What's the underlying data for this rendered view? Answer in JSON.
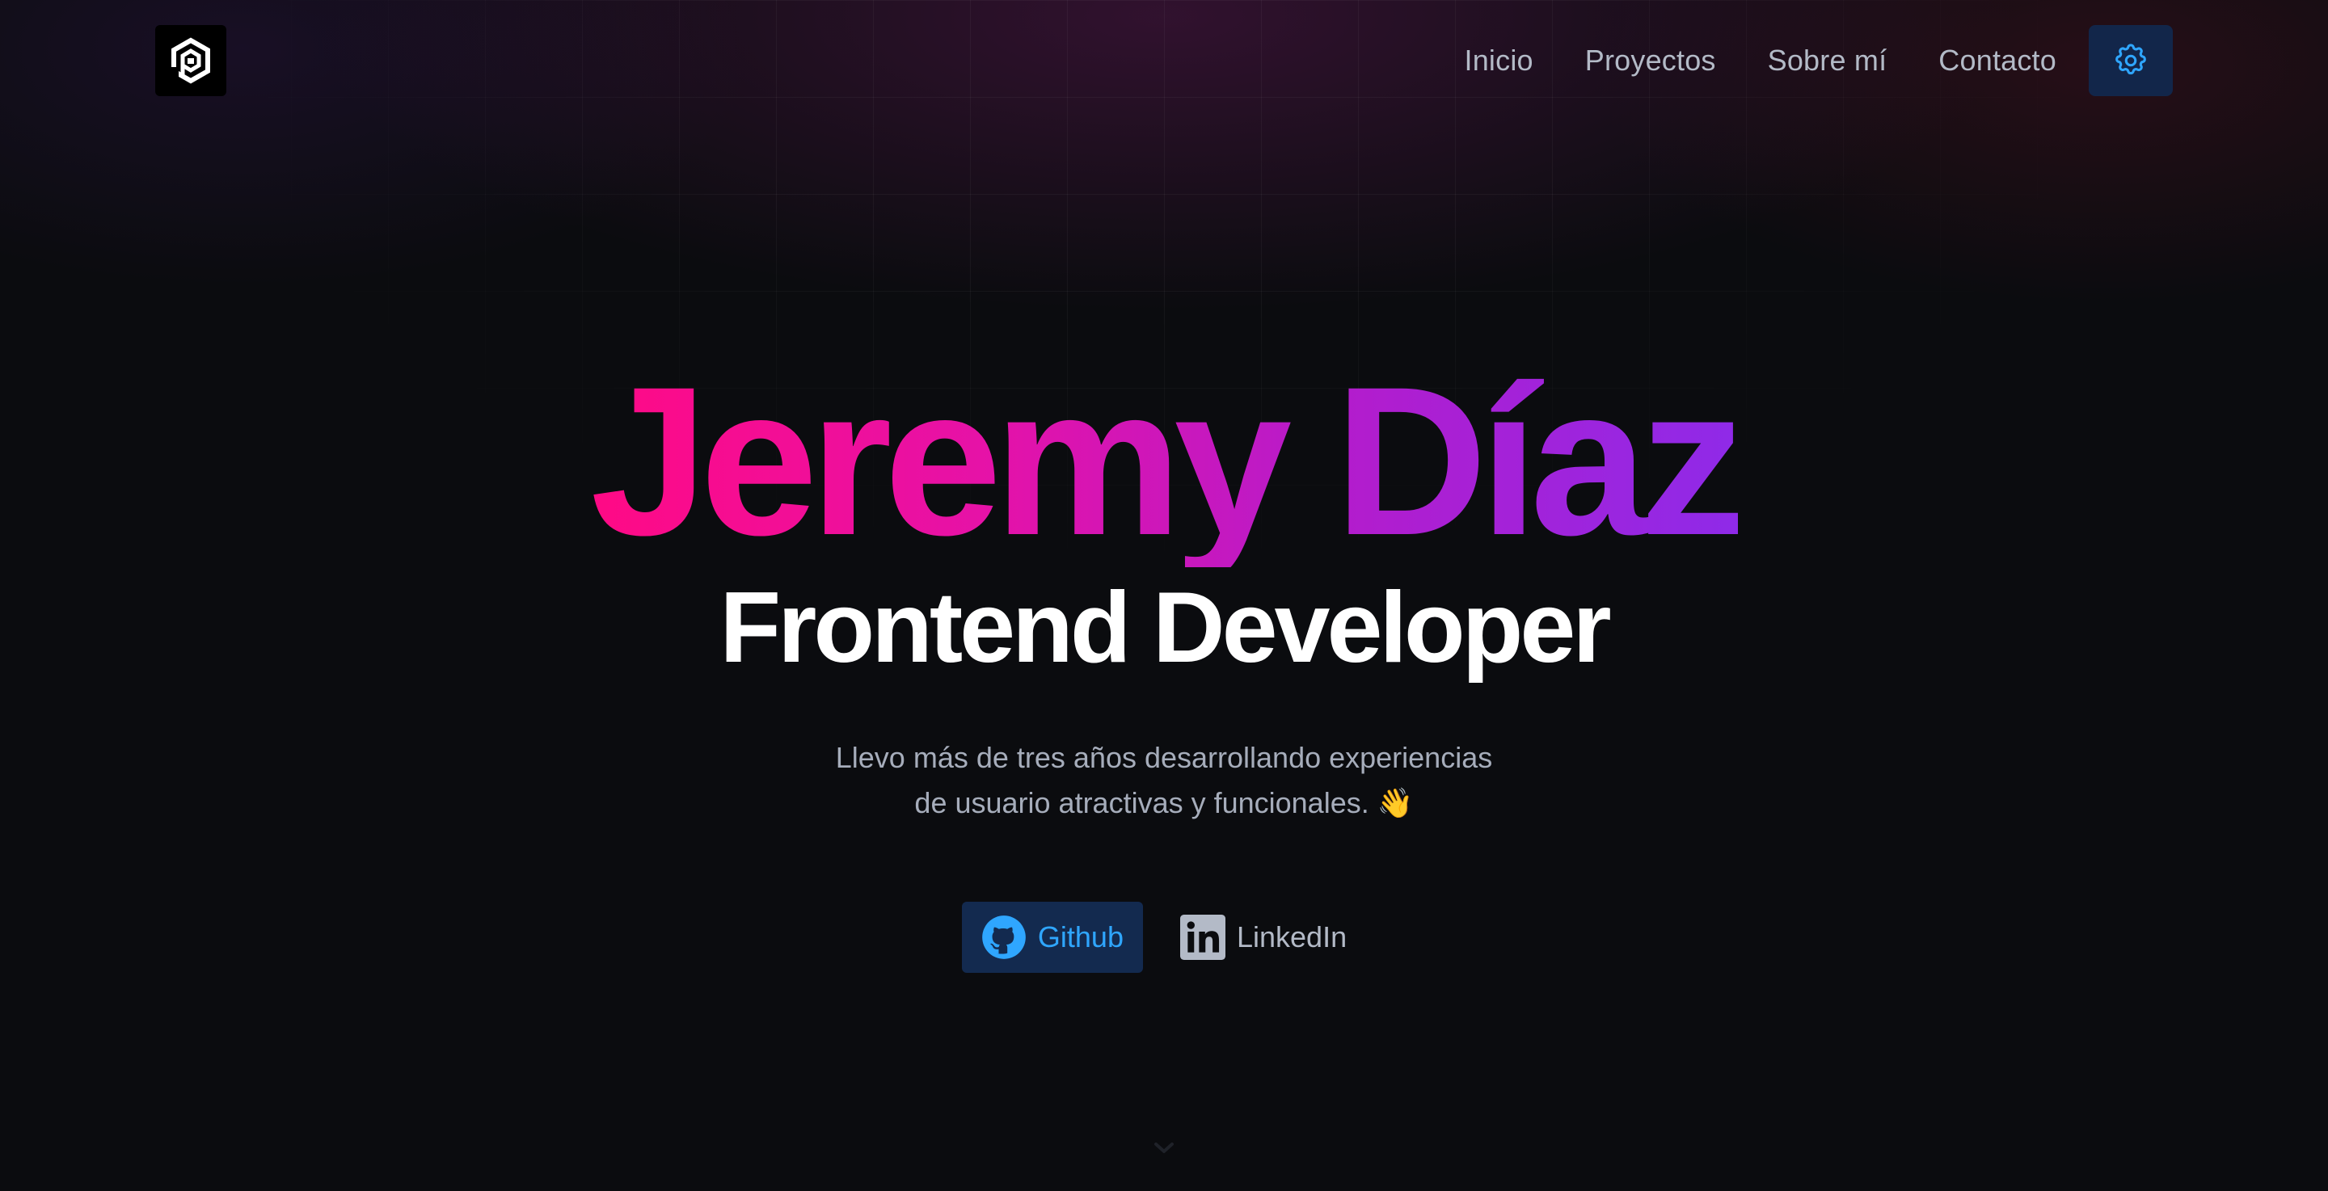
{
  "header": {
    "nav": [
      {
        "label": "Inicio"
      },
      {
        "label": "Proyectos"
      },
      {
        "label": "Sobre mí"
      },
      {
        "label": "Contacto"
      }
    ],
    "logo_icon": "hexagon-spiral-logo",
    "settings_icon": "gear-icon"
  },
  "hero": {
    "name": "Jeremy Díaz",
    "role": "Frontend Developer",
    "description_line1": "Llevo más de tres años desarrollando experiencias",
    "description_line2": "de usuario atractivas y funcionales. 👋",
    "links": {
      "github_label": "Github",
      "linkedin_label": "LinkedIn"
    }
  },
  "colors": {
    "background": "#0b0c0f",
    "accent_blue": "#2fa6ff",
    "button_bg": "#132a4f",
    "gradient_start": "#ff0a85",
    "gradient_end": "#8f2ae8",
    "nav_text": "#b3bac7"
  },
  "icons": [
    "hexagon-spiral-logo",
    "gear-icon",
    "github-icon",
    "linkedin-icon",
    "chevron-down-icon"
  ]
}
